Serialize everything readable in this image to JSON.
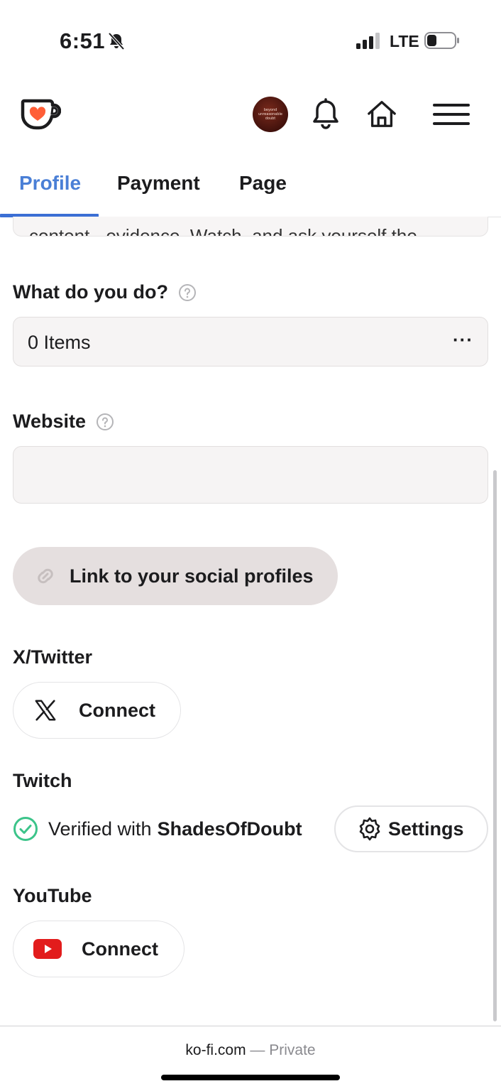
{
  "status_bar": {
    "time": "6:51",
    "network": "LTE"
  },
  "header": {
    "logo_icon": "ko-fi-cup-icon",
    "avatar_text": [
      "beyond",
      "unreasonable",
      "doubt"
    ],
    "icons": [
      "bell-icon",
      "home-icon",
      "hamburger-menu-icon"
    ]
  },
  "tabs": [
    {
      "label": "Profile",
      "active": true
    },
    {
      "label": "Payment",
      "active": false
    },
    {
      "label": "Page",
      "active": false
    }
  ],
  "form": {
    "clipped_text": "content - evidence. Watch, and ask yourself the",
    "what_do_you_do": {
      "label": "What do you do?",
      "value": "0 Items",
      "more": "···"
    },
    "website": {
      "label": "Website",
      "value": ""
    },
    "social_button": "Link to your social profiles"
  },
  "socials": {
    "twitter": {
      "label": "X/Twitter",
      "button": "Connect"
    },
    "twitch": {
      "label": "Twitch",
      "verified_prefix": "Verified with",
      "verified_user": "ShadesOfDoubt",
      "settings": "Settings"
    },
    "youtube": {
      "label": "YouTube",
      "button": "Connect"
    }
  },
  "url_bar": {
    "domain": "ko-fi.com",
    "separator": " — ",
    "mode": "Private"
  },
  "colors": {
    "accent_blue": "#3b6fd4",
    "kofi_orange": "#ff5e37",
    "verified_green": "#3cc48a",
    "youtube_red": "#e21c1c"
  }
}
